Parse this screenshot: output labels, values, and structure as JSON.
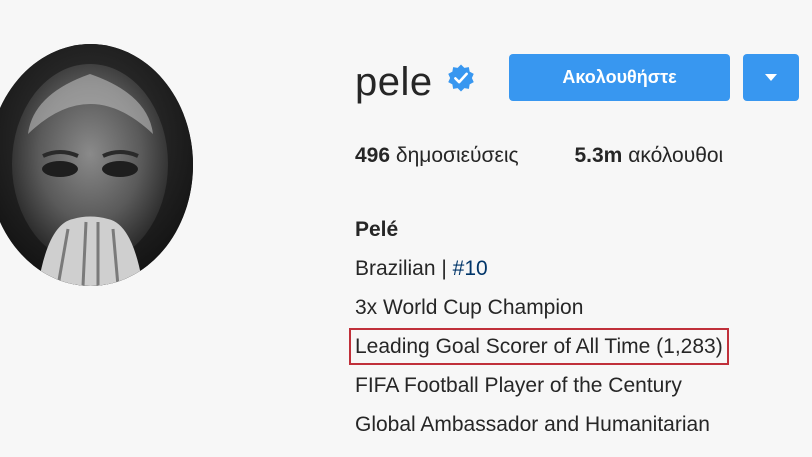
{
  "profile": {
    "username": "pele",
    "follow_label": "Ακολουθήστε",
    "stats": [
      {
        "count": "496",
        "label": "δημοσιεύσεις"
      },
      {
        "count": "5.3m",
        "label": "ακόλουθοι"
      }
    ],
    "bio": {
      "full_name": "Pelé",
      "line1_text": "Brazilian | ",
      "line1_hashtag": "#10",
      "line2": "3x World Cup Champion",
      "line3": "Leading Goal Scorer of All Time (1,283)",
      "line4": "FIFA Football Player of the Century",
      "line5": "Global Ambassador and Humanitarian"
    }
  },
  "colors": {
    "accent": "#3897f0",
    "highlight_border": "#c0303a",
    "hashtag": "#003569"
  }
}
